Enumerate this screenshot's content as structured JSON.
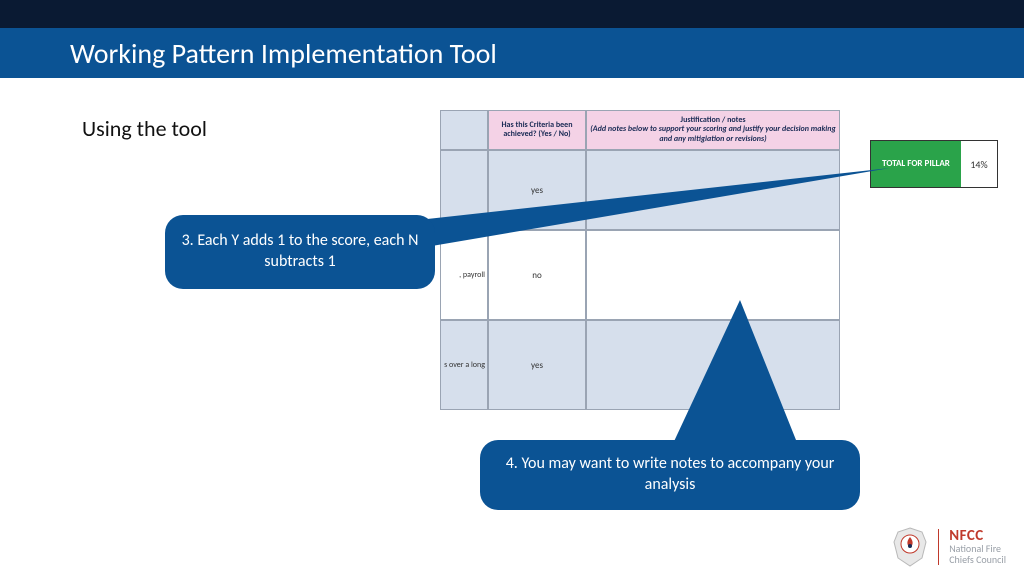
{
  "title": "Working Pattern Implementation Tool",
  "subtitle": "Using the tool",
  "sheet": {
    "header_mid": "Has this Criteria been achieved? (Yes / No)",
    "header_right_t1": "Justification / notes",
    "header_right_t2": "(Add notes below to support your scoring and justify your decision making and any mitigiation or revisions)",
    "rows": [
      {
        "frag": "",
        "ans": "yes"
      },
      {
        "frag": ", payroll",
        "ans": "no"
      },
      {
        "frag": "s over a long",
        "ans": "yes"
      }
    ]
  },
  "pillar": {
    "label": "TOTAL FOR PILLAR",
    "value": "14%"
  },
  "callouts": {
    "c3": "3. Each Y adds 1 to the score, each N subtracts 1",
    "c4": "4. You may want to write notes to accompany your analysis"
  },
  "logo": {
    "abbr": "NFCC",
    "line1": "National Fire",
    "line2": "Chiefs Council"
  },
  "colors": {
    "brand_blue": "#0b5394",
    "dark_top": "#0a1a33",
    "green": "#2aa34a",
    "pink": "#f4d2e6",
    "sheet_blue": "#d6dfec",
    "nfcc_red": "#c0392b"
  }
}
